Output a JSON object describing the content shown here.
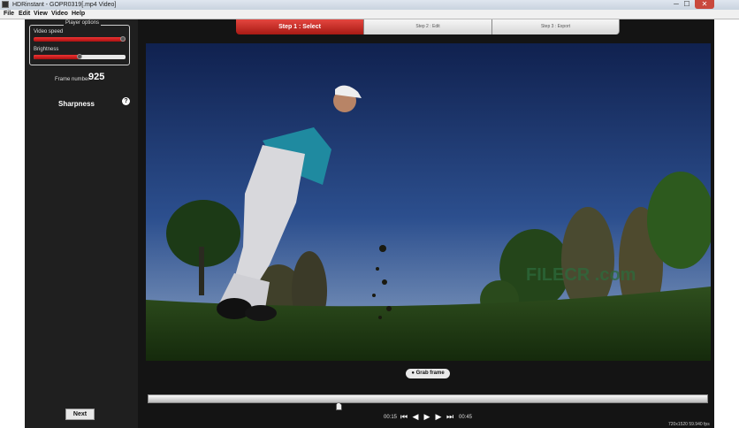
{
  "window": {
    "title": "HDRinstant - GOPR0319[.mp4 Video]",
    "minimize": "─",
    "maximize": "☐",
    "close": "✕"
  },
  "menu": [
    "File",
    "Edit",
    "View",
    "Video",
    "Help"
  ],
  "player_options": {
    "title": "Player options",
    "video_speed": {
      "label": "Video speed",
      "value": 1.0
    },
    "brightness": {
      "label": "Brightness",
      "value": 0.5
    }
  },
  "frame": {
    "label": "Frame number",
    "value": "925"
  },
  "sharpness": {
    "label": "Sharpness",
    "help": "?"
  },
  "next_label": "Next",
  "steps": [
    {
      "label": "Step 1 : Select",
      "active": true
    },
    {
      "label": "Step 2 : Edit",
      "active": false
    },
    {
      "label": "Step 3 : Export",
      "active": false
    }
  ],
  "grab_frame_label": "Grab frame",
  "playback": {
    "current": "00:15",
    "total": "00:45",
    "position": 0.34
  },
  "status": "720x1520  59.940 fps",
  "watermark": "FILECR .com",
  "colors": {
    "accent": "#d7302a",
    "panel": "#1f1f1f"
  }
}
